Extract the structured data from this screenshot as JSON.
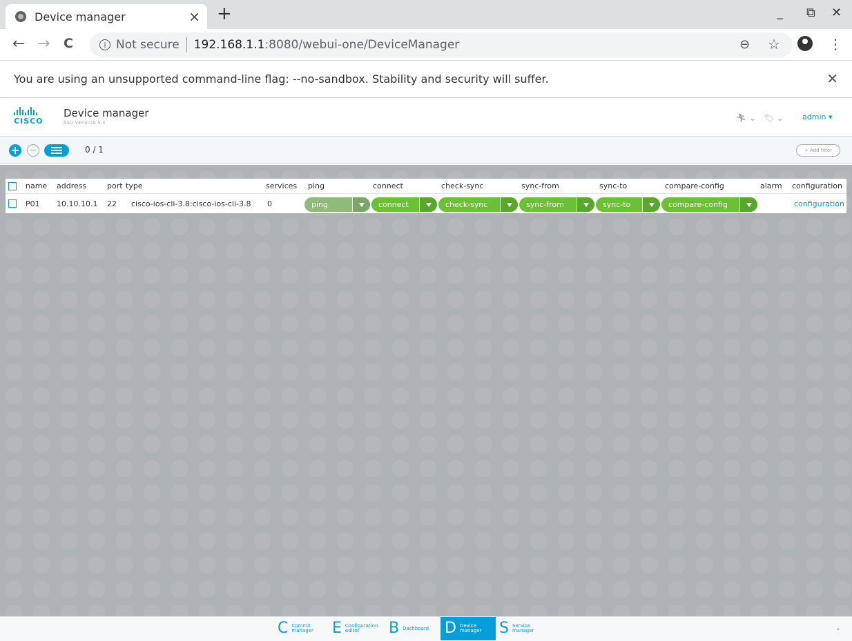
{
  "browser": {
    "tab_title": "Device manager",
    "tab_close": "×",
    "new_tab": "+",
    "minimize": "_",
    "restore": "⧉",
    "close": "✕",
    "back": "←",
    "forward": "→",
    "reload": "C",
    "security_label": "Not secure",
    "url_host": "192.168.1.1",
    "url_path": ":8080/webui-one/DeviceManager",
    "zoom_icon": "⊖",
    "star_icon": "☆",
    "menu_icon": "⋮"
  },
  "infobar": {
    "message": "You are using an unsupported command-line flag: --no-sandbox. Stability and security will suffer.",
    "close": "✕"
  },
  "app": {
    "logo_text": "CISCO",
    "title": "Device manager",
    "version": "NSO VERSION 5.3",
    "icon1": "🏃︎ ⌄",
    "icon2": "🏷︎ ⌄",
    "user": "admin ▾"
  },
  "toolbar": {
    "add": "+",
    "remove": "−",
    "count": "0 / 1",
    "filter_label": "+ Add filter"
  },
  "table": {
    "columns": {
      "name": "name",
      "address": "address",
      "port": "port",
      "type": "type",
      "services": "services",
      "ping": "ping",
      "connect": "connect",
      "check_sync": "check-sync",
      "sync_from": "sync-from",
      "sync_to": "sync-to",
      "compare_config": "compare-config",
      "alarm": "alarm",
      "configuration": "configuration"
    },
    "rows": [
      {
        "name": "P01",
        "address": "10.10.10.1",
        "port": "22",
        "type": "cisco-ios-cli-3.8:cisco-ios-cli-3.8",
        "services": "0",
        "ping": "ping",
        "connect": "connect",
        "check_sync": "check-sync",
        "sync_from": "sync-from",
        "sync_to": "sync-to",
        "compare_config": "compare-config",
        "alarm": "",
        "configuration": "configuration"
      }
    ]
  },
  "dock": {
    "items": [
      {
        "letter": "C",
        "label": "Commit\nmanager"
      },
      {
        "letter": "E",
        "label": "Configuration\neditor"
      },
      {
        "letter": "B",
        "label": "Dashboard"
      },
      {
        "letter": "D",
        "label": "Device\nmanager"
      },
      {
        "letter": "S",
        "label": "Service\nmanager"
      }
    ],
    "chevron": "⌄"
  }
}
